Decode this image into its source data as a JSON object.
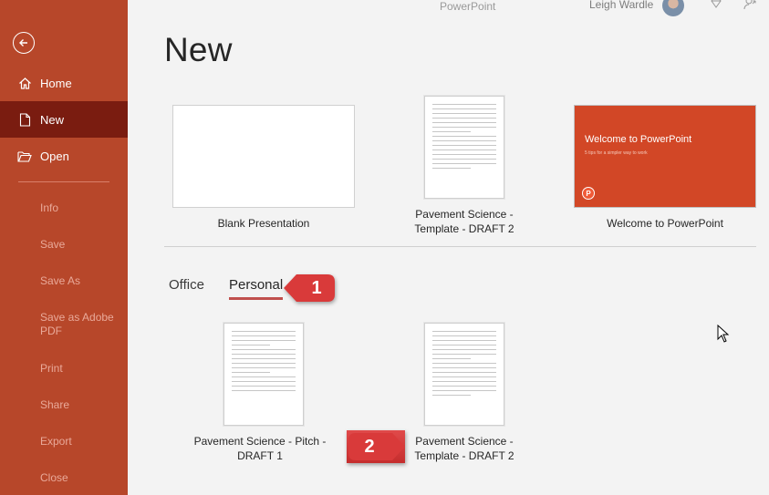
{
  "app": {
    "title": "PowerPoint"
  },
  "user": {
    "name": "Leigh Wardle"
  },
  "sidebar": {
    "items": [
      {
        "label": "Home",
        "icon": "home-icon"
      },
      {
        "label": "New",
        "icon": "new-document-icon",
        "active": true
      },
      {
        "label": "Open",
        "icon": "folder-open-icon"
      }
    ],
    "sub_items": [
      "Info",
      "Save",
      "Save As",
      "Save as Adobe PDF",
      "Print",
      "Share",
      "Export",
      "Close"
    ]
  },
  "main": {
    "title": "New",
    "featured": [
      {
        "label": "Blank Presentation"
      },
      {
        "label": "Pavement Science - Template - DRAFT 2"
      },
      {
        "label": "Welcome to PowerPoint",
        "slide_title": "Welcome to PowerPoint",
        "slide_subtitle": "5 tips for a simpler way to work"
      }
    ],
    "tabs": [
      {
        "label": "Office"
      },
      {
        "label": "Personal",
        "active": true
      }
    ],
    "personal": [
      {
        "label": "Pavement Science - Pitch - DRAFT 1"
      },
      {
        "label": "Pavement Science - Template - DRAFT 2"
      }
    ],
    "callouts": [
      "1",
      "2"
    ]
  },
  "colors": {
    "sidebar": "#b7472a",
    "active": "#7a1c10",
    "accent": "#d24726",
    "callout": "#d93a3a"
  }
}
